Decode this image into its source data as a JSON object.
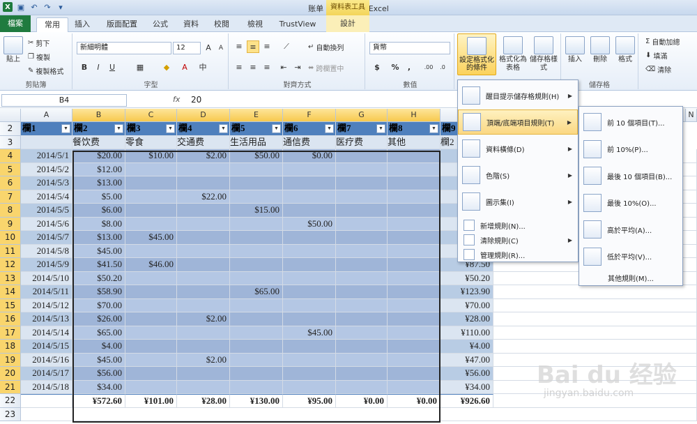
{
  "window": {
    "title": "账单 - Microsoft Excel",
    "context_tab": "資料表工具"
  },
  "tabs": [
    "檔案",
    "常用",
    "插入",
    "版面配置",
    "公式",
    "資料",
    "校閱",
    "檢視",
    "TrustView",
    "設計"
  ],
  "ribbon": {
    "clipboard": {
      "label": "剪貼簿",
      "paste": "貼上",
      "cut": "剪下",
      "copy": "複製",
      "format_painter": "複製格式"
    },
    "font": {
      "label": "字型",
      "name": "新細明體",
      "size": "12",
      "bold": "B",
      "italic": "I",
      "underline": "U"
    },
    "alignment": {
      "label": "對齊方式",
      "wrap": "自動換列",
      "merge": "跨欄置中"
    },
    "number": {
      "label": "數值",
      "format": "貨幣",
      "currency": "$",
      "percent": "%",
      "comma": ","
    },
    "styles": {
      "conditional": "設定格式化的條件",
      "as_table": "格式化為表格",
      "cell_styles": "儲存格樣式"
    },
    "cells": {
      "label": "儲存格",
      "insert": "插入",
      "delete": "刪除",
      "format": "格式"
    },
    "editing": {
      "autosum": "自動加總",
      "fill": "填滿",
      "clear": "清除"
    }
  },
  "formula_bar": {
    "name_box": "B4",
    "fx": "fx",
    "value": "20"
  },
  "columns": [
    "A",
    "B",
    "C",
    "D",
    "E",
    "F",
    "G",
    "H",
    "I"
  ],
  "extra_column": "N",
  "header_row": {
    "row": "2",
    "labels": [
      "欄1",
      "欄2",
      "欄3",
      "欄4",
      "欄5",
      "欄6",
      "欄7",
      "欄8",
      "欄9"
    ]
  },
  "subheader_row": {
    "row": "3",
    "labels": [
      "",
      "餐饮费",
      "零食",
      "交通费",
      "生活用品",
      "通信费",
      "医疗费",
      "其他",
      "欄2"
    ]
  },
  "rows": [
    {
      "n": "4",
      "cells": [
        "2014/5/1",
        "$20.00",
        "$10.00",
        "$2.00",
        "$50.00",
        "$0.00",
        "",
        "",
        ""
      ]
    },
    {
      "n": "5",
      "cells": [
        "2014/5/2",
        "$12.00",
        "",
        "",
        "",
        "",
        "",
        "",
        ""
      ]
    },
    {
      "n": "6",
      "cells": [
        "2014/5/3",
        "$13.00",
        "",
        "",
        "",
        "",
        "",
        "",
        ""
      ]
    },
    {
      "n": "7",
      "cells": [
        "2014/5/4",
        "$5.00",
        "",
        "$22.00",
        "",
        "",
        "",
        "",
        ""
      ]
    },
    {
      "n": "8",
      "cells": [
        "2014/5/5",
        "$6.00",
        "",
        "",
        "$15.00",
        "",
        "",
        "",
        ""
      ]
    },
    {
      "n": "9",
      "cells": [
        "2014/5/6",
        "$8.00",
        "",
        "",
        "",
        "$50.00",
        "",
        "",
        ""
      ]
    },
    {
      "n": "10",
      "cells": [
        "2014/5/7",
        "$13.00",
        "$45.00",
        "",
        "",
        "",
        "",
        "",
        ""
      ]
    },
    {
      "n": "11",
      "cells": [
        "2014/5/8",
        "$45.00",
        "",
        "",
        "",
        "",
        "",
        "",
        ""
      ]
    },
    {
      "n": "12",
      "cells": [
        "2014/5/9",
        "$41.50",
        "$46.00",
        "",
        "",
        "",
        "",
        "",
        "¥87.50"
      ]
    },
    {
      "n": "13",
      "cells": [
        "2014/5/10",
        "$50.20",
        "",
        "",
        "",
        "",
        "",
        "",
        "¥50.20"
      ]
    },
    {
      "n": "14",
      "cells": [
        "2014/5/11",
        "$58.90",
        "",
        "",
        "$65.00",
        "",
        "",
        "",
        "¥123.90"
      ]
    },
    {
      "n": "15",
      "cells": [
        "2014/5/12",
        "$70.00",
        "",
        "",
        "",
        "",
        "",
        "",
        "¥70.00"
      ]
    },
    {
      "n": "16",
      "cells": [
        "2014/5/13",
        "$26.00",
        "",
        "$2.00",
        "",
        "",
        "",
        "",
        "¥28.00"
      ]
    },
    {
      "n": "17",
      "cells": [
        "2014/5/14",
        "$65.00",
        "",
        "",
        "",
        "$45.00",
        "",
        "",
        "¥110.00"
      ]
    },
    {
      "n": "18",
      "cells": [
        "2014/5/15",
        "$4.00",
        "",
        "",
        "",
        "",
        "",
        "",
        "¥4.00"
      ]
    },
    {
      "n": "19",
      "cells": [
        "2014/5/16",
        "$45.00",
        "",
        "$2.00",
        "",
        "",
        "",
        "",
        "¥47.00"
      ]
    },
    {
      "n": "20",
      "cells": [
        "2014/5/17",
        "$56.00",
        "",
        "",
        "",
        "",
        "",
        "",
        "¥56.00"
      ]
    },
    {
      "n": "21",
      "cells": [
        "2014/5/18",
        "$34.00",
        "",
        "",
        "",
        "",
        "",
        "",
        "¥34.00"
      ]
    }
  ],
  "total_row": {
    "n": "22",
    "cells": [
      "",
      "¥572.60",
      "¥101.00",
      "¥28.00",
      "¥130.00",
      "¥95.00",
      "¥0.00",
      "¥0.00",
      "¥926.60"
    ]
  },
  "last_row": "23",
  "cf_menu": {
    "items": [
      "醒目提示儲存格規則(H)",
      "頂端/底端項目規則(T)",
      "資料橫條(D)",
      "色階(S)",
      "圖示集(I)"
    ],
    "small_items": [
      "新增規則(N)...",
      "清除規則(C)",
      "管理規則(R)..."
    ]
  },
  "submenu": {
    "items": [
      "前 10 個項目(T)...",
      "前 10%(P)...",
      "最後 10 個項目(B)...",
      "最後 10%(O)...",
      "高於平均(A)...",
      "低於平均(V)..."
    ],
    "more": "其他規則(M)..."
  },
  "watermark": {
    "text": "Bai du 经验",
    "url": "jingyan.baidu.com"
  }
}
